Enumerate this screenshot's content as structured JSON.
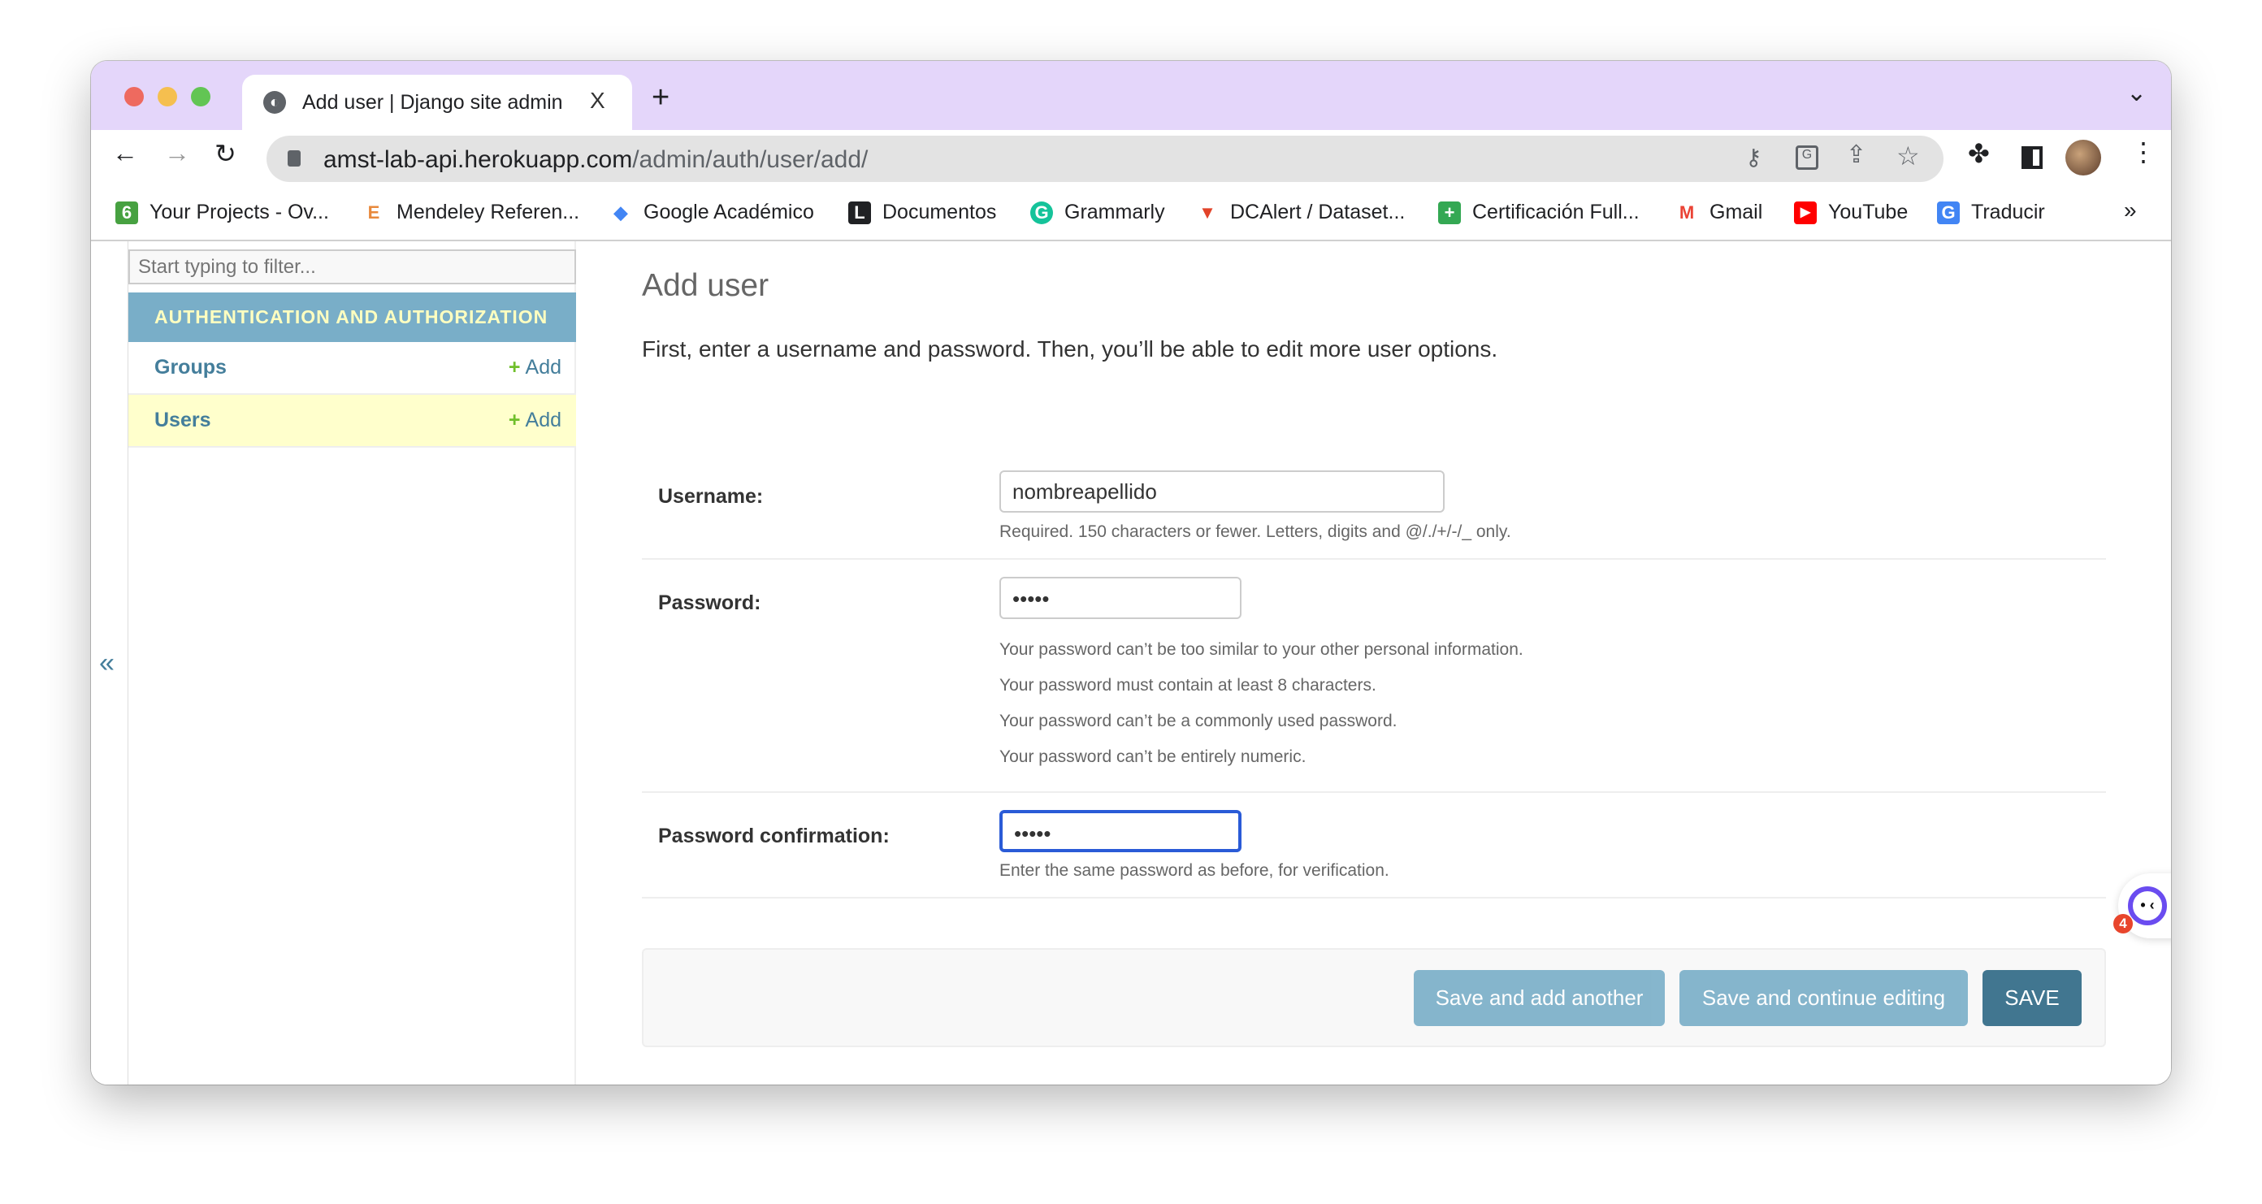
{
  "browser": {
    "tab_title": "Add user | Django site admin",
    "tab_close": "X",
    "new_tab": "+",
    "url_host": "amst-lab-api.herokuapp.com",
    "url_path": "/admin/auth/user/add/",
    "tab_menu": "⌄",
    "more_bookmarks": "»",
    "bookmarks": [
      {
        "label": "Your Projects - Ov...",
        "icon": "overleaf-icon",
        "color": "#47a141",
        "glyph": "6"
      },
      {
        "label": "Mendeley Referen...",
        "icon": "mendeley-icon",
        "color": "#e8893c",
        "glyph": "E"
      },
      {
        "label": "Google Académico",
        "icon": "google-scholar-icon",
        "color": "#4285f4",
        "glyph": "◆"
      },
      {
        "label": "Documentos",
        "icon": "documentos-icon",
        "color": "#202124",
        "glyph": "L"
      },
      {
        "label": "Grammarly",
        "icon": "grammarly-icon",
        "color": "#15c39a",
        "glyph": "G"
      },
      {
        "label": "DCAlert / Dataset...",
        "icon": "gitlab-icon",
        "color": "#e24329",
        "glyph": "▼"
      },
      {
        "label": "Certificación Full...",
        "icon": "sheets-icon",
        "color": "#34a853",
        "glyph": "+"
      },
      {
        "label": "Gmail",
        "icon": "gmail-icon",
        "color": "#ea4335",
        "glyph": "M"
      },
      {
        "label": "YouTube",
        "icon": "youtube-icon",
        "color": "#ff0000",
        "glyph": "▶"
      },
      {
        "label": "Traducir",
        "icon": "translate-icon",
        "color": "#4285f4",
        "glyph": "G"
      }
    ]
  },
  "sidebar": {
    "filter_placeholder": "Start typing to filter...",
    "module_title": "AUTHENTICATION AND AUTHORIZATION",
    "items": [
      {
        "label": "Groups",
        "add": "Add",
        "active": false
      },
      {
        "label": "Users",
        "add": "Add",
        "active": true
      }
    ],
    "collapse": "«"
  },
  "main": {
    "title": "Add user",
    "intro": "First, enter a username and password. Then, you’ll be able to edit more user options.",
    "username": {
      "label": "Username:",
      "value": "nombreapellido",
      "help": "Required. 150 characters or fewer. Letters, digits and @/./+/-/_ only."
    },
    "password": {
      "label": "Password:",
      "value": "•••••",
      "help": [
        "Your password can’t be too similar to your other personal information.",
        "Your password must contain at least 8 characters.",
        "Your password can’t be a commonly used password.",
        "Your password can’t be entirely numeric."
      ]
    },
    "password_confirm": {
      "label": "Password confirmation:",
      "value": "•••••",
      "help": "Enter the same password as before, for verification."
    },
    "buttons": {
      "save_add_another": "Save and add another",
      "save_continue": "Save and continue editing",
      "save": "SAVE"
    }
  },
  "widget": {
    "badge": "4"
  },
  "colors": {
    "accent": "#79aec8",
    "header_text": "#ffffc0",
    "link": "#447e9b",
    "save": "#417690",
    "focus": "#2a5bd7",
    "tabstrip": "#e4d6fa"
  }
}
